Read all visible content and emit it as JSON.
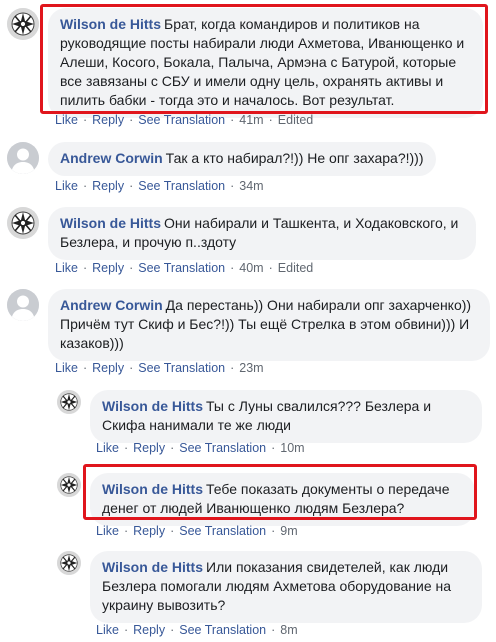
{
  "comments": [
    {
      "author": "Wilson de Hitts",
      "text": "Брат, когда командиров и политиков на руководящие посты набирали люди Ахметова, Иванющенко и Алеши, Косого, Бокала, Палыча, Армэна с Батурой, которые все завязаны с СБУ и имели одну цель, охранять активы и пилить бабки - тогда это и началось. Вот результат.",
      "time": "41m",
      "edited": "Edited"
    },
    {
      "author": "Andrew Corwin",
      "text": "Так а кто набирал?!)) Не опг захара?!)))",
      "time": "34m"
    },
    {
      "author": "Wilson de Hitts",
      "text": "Они набирали и Ташкента, и Ходаковского, и Безлера, и прочую п..здоту",
      "time": "40m",
      "edited": "Edited"
    },
    {
      "author": "Andrew Corwin",
      "text": "Да перестань)) Они набирали опг захарченко)) Причём тут Скиф и Бес?!)) Ты ещё Стрелка в этом обвини))) И казаков)))",
      "time": "23m"
    },
    {
      "author": "Wilson de Hitts",
      "text": "Ты с Луны свалился??? Безлера и Скифа нанимали те же люди",
      "time": "10m"
    },
    {
      "author": "Wilson de Hitts",
      "text": "Тебе показать документы о передаче денег от людей Иванющенко людям Безлера?",
      "time": "9m"
    },
    {
      "author": "Wilson de Hitts",
      "text": "Или показания свидетелей, как люди Безлера помогали людям Ахметова оборудование на украину вывозить?",
      "time": "8m"
    }
  ],
  "actions": {
    "like": "Like",
    "reply": "Reply",
    "see_translation": "See Translation",
    "separator": "·"
  },
  "colors": {
    "author_link": "#385898",
    "bubble_bg": "#f2f3f5",
    "highlight_border": "#e0151c",
    "meta_text": "#606770"
  },
  "icons": {
    "wilson_avatar": "emblem-avatar-icon",
    "andrew_avatar": "default-person-avatar-icon"
  }
}
